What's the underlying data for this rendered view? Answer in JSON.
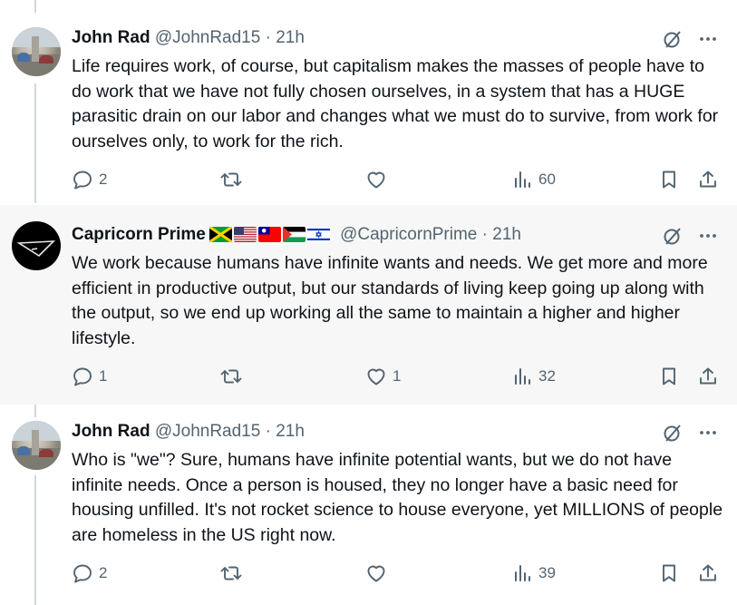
{
  "tweets": [
    {
      "name": "John Rad",
      "handle": "@JohnRad15",
      "time": "· 21h",
      "text": "Life requires work, of course, but capitalism makes the masses of people have to do work that we have not fully chosen ourselves, in a system that has a HUGE parasitic drain on our labor and changes what we must do to survive, from work for ourselves only, to work for the rich.",
      "replies": "2",
      "retweets": "",
      "likes": "",
      "views": "60"
    },
    {
      "name": "Capricorn Prime",
      "flags": [
        "jamaica-flag",
        "usa-flag",
        "taiwan-flag",
        "palestine-flag",
        "israel-flag"
      ],
      "handle": "@CapricornPrime",
      "time": "· 21h",
      "text": "We work because humans have infinite wants and needs. We get more and more efficient in productive output, but our standards of living keep going up along with the output, so we end up working all the same to maintain a higher and higher lifestyle.",
      "replies": "1",
      "retweets": "",
      "likes": "1",
      "views": "32"
    },
    {
      "name": "John Rad",
      "handle": "@JohnRad15",
      "time": "· 21h",
      "text": "Who is \"we\"? Sure, humans have infinite potential wants, but we do not have infinite needs. Once a person is housed, they no longer have a basic need for housing unfilled. It's not rocket science to house everyone, yet MILLIONS of people are homeless in the US right now.",
      "replies": "2",
      "retweets": "",
      "likes": "",
      "views": "39"
    }
  ],
  "icons": {
    "top": [
      "grok-icon",
      "more-icon"
    ],
    "actions": [
      "reply-icon",
      "retweet-icon",
      "like-icon",
      "views-icon",
      "bookmark-icon",
      "share-icon"
    ]
  }
}
